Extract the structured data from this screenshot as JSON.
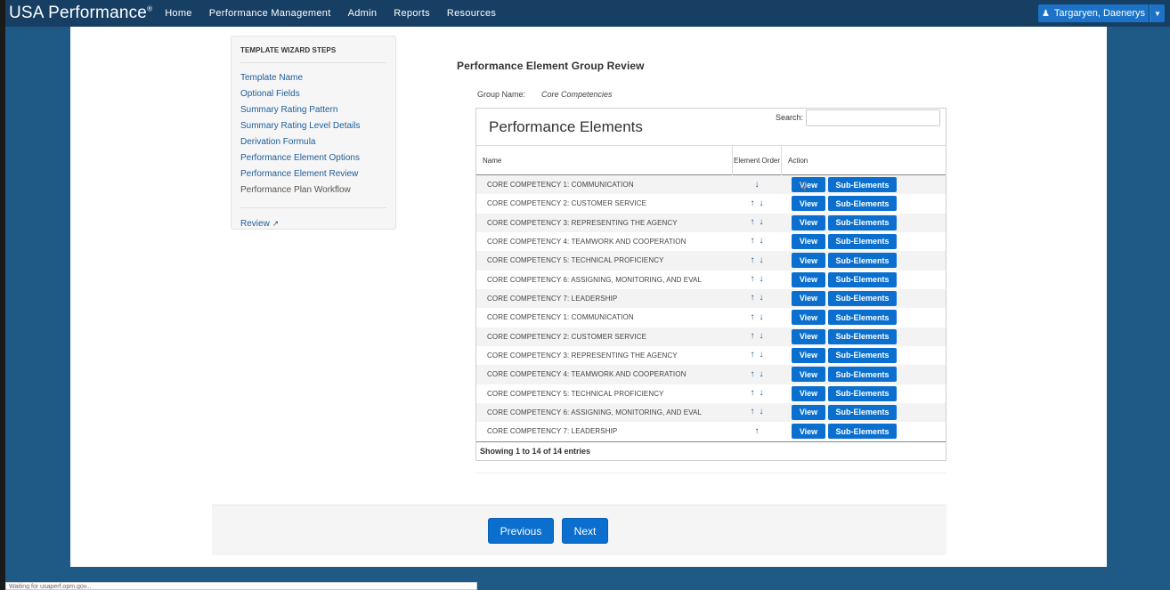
{
  "nav": {
    "brand": "USA Performance",
    "brand_mark": "®",
    "items": [
      "Home",
      "Performance Management",
      "Admin",
      "Reports",
      "Resources"
    ],
    "user_name": "Targaryen, Daenerys",
    "user_icon": "user-icon",
    "caret_icon": "caret-down-icon"
  },
  "wizard": {
    "title": "TEMPLATE WIZARD STEPS",
    "steps": [
      {
        "label": "Template Name"
      },
      {
        "label": "Optional Fields"
      },
      {
        "label": "Summary Rating Pattern"
      },
      {
        "label": "Summary Rating Level Details"
      },
      {
        "label": "Derivation Formula"
      },
      {
        "label": "Performance Element Options"
      },
      {
        "label": "Performance Element Review"
      },
      {
        "label": "Performance Plan Workflow"
      }
    ],
    "review_label": "Review",
    "review_icon": "external-link-icon"
  },
  "review": {
    "title": "Performance Element Group Review",
    "group_name_label": "Group Name:",
    "group_name_value": "Core Competencies"
  },
  "table": {
    "panel_title": "Performance Elements",
    "search_label": "Search:",
    "search_value": "",
    "columns": {
      "name": "Name",
      "order": "Element Order",
      "action": "Action"
    },
    "view_label": "View",
    "sub_label": "Sub-Elements",
    "rows": [
      {
        "name": "CORE COMPETENCY 1: COMMUNICATION",
        "up": false,
        "down": true
      },
      {
        "name": "CORE COMPETENCY 2: CUSTOMER SERVICE",
        "up": true,
        "down": true
      },
      {
        "name": "CORE COMPETENCY 3: REPRESENTING THE AGENCY",
        "up": true,
        "down": true
      },
      {
        "name": "CORE COMPETENCY 4: TEAMWORK AND COOPERATION",
        "up": true,
        "down": true
      },
      {
        "name": "CORE COMPETENCY 5: TECHNICAL PROFICIENCY",
        "up": true,
        "down": true
      },
      {
        "name": "CORE COMPETENCY 6: ASSIGNING, MONITORING, AND EVAL",
        "up": true,
        "down": true
      },
      {
        "name": "CORE COMPETENCY 7: LEADERSHIP",
        "up": true,
        "down": true
      },
      {
        "name": "CORE COMPETENCY 1: COMMUNICATION",
        "up": true,
        "down": true
      },
      {
        "name": "CORE COMPETENCY 2: CUSTOMER SERVICE",
        "up": true,
        "down": true
      },
      {
        "name": "CORE COMPETENCY 3: REPRESENTING THE AGENCY",
        "up": true,
        "down": true
      },
      {
        "name": "CORE COMPETENCY 4: TEAMWORK AND COOPERATION",
        "up": true,
        "down": true
      },
      {
        "name": "CORE COMPETENCY 5: TECHNICAL PROFICIENCY",
        "up": true,
        "down": true
      },
      {
        "name": "CORE COMPETENCY 6: ASSIGNING, MONITORING, AND EVAL",
        "up": true,
        "down": true
      },
      {
        "name": "CORE COMPETENCY 7: LEADERSHIP",
        "up": true,
        "down": false
      }
    ],
    "footer_info": "Showing 1 to 14 of 14 entries"
  },
  "buttons": {
    "previous": "Previous",
    "next": "Next"
  },
  "status_bar": "Waiting for usaperf.opm.gov..."
}
